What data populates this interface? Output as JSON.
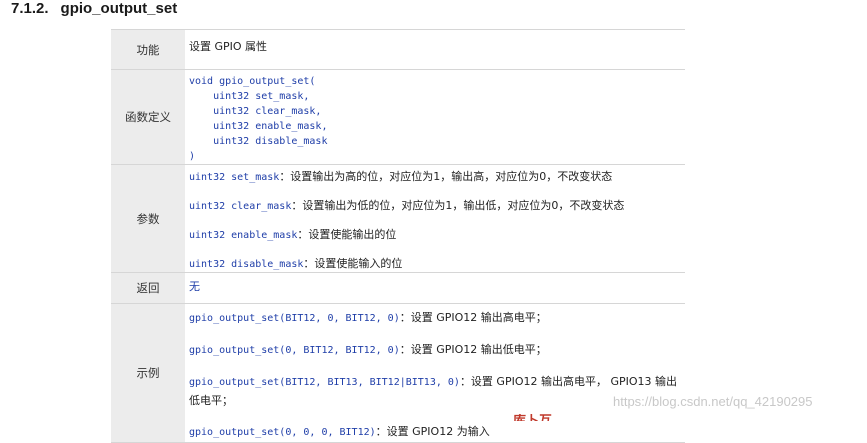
{
  "section": {
    "number": "7.1.2.",
    "title": "gpio_output_set"
  },
  "table": {
    "func": {
      "label": "功能",
      "text": "设置 GPIO 属性"
    },
    "definition": {
      "label": "函数定义",
      "lines": [
        "void gpio_output_set(",
        "    uint32 set_mask,",
        "    uint32 clear_mask,",
        "    uint32 enable_mask,",
        "    uint32 disable_mask",
        ")"
      ]
    },
    "params": {
      "label": "参数",
      "items": [
        {
          "code": "uint32 set_mask",
          "desc": "：设置输出为高的位，对应位为1，输出高，对应位为0，不改变状态"
        },
        {
          "code": "uint32 clear_mask",
          "desc": "：设置输出为低的位，对应位为1，输出低，对应位为0，不改变状态"
        },
        {
          "code": "uint32 enable_mask",
          "desc": "：设置使能输出的位"
        },
        {
          "code": "uint32 disable_mask",
          "desc": "：设置使能输入的位"
        }
      ]
    },
    "returns": {
      "label": "返回",
      "value": "无"
    },
    "examples": {
      "label": "示例",
      "items": [
        {
          "code": "gpio_output_set(BIT12, 0, BIT12, 0)",
          "desc": "：设置 GPIO12 输出高电平；"
        },
        {
          "code": "gpio_output_set(0, BIT12, BIT12, 0)",
          "desc": "：设置 GPIO12 输出低电平；"
        },
        {
          "code": "gpio_output_set(BIT12, BIT13, BIT12|BIT13, 0)",
          "desc": "：设置 GPIO12 输出高电平， GPIO13 输出低电平；"
        },
        {
          "code": "gpio_output_set(0, 0, 0, BIT12)",
          "desc": "：设置 GPIO12 为输入"
        }
      ]
    }
  },
  "watermark": "https://blog.csdn.net/qq_42190295",
  "cut_text": "库卜互"
}
